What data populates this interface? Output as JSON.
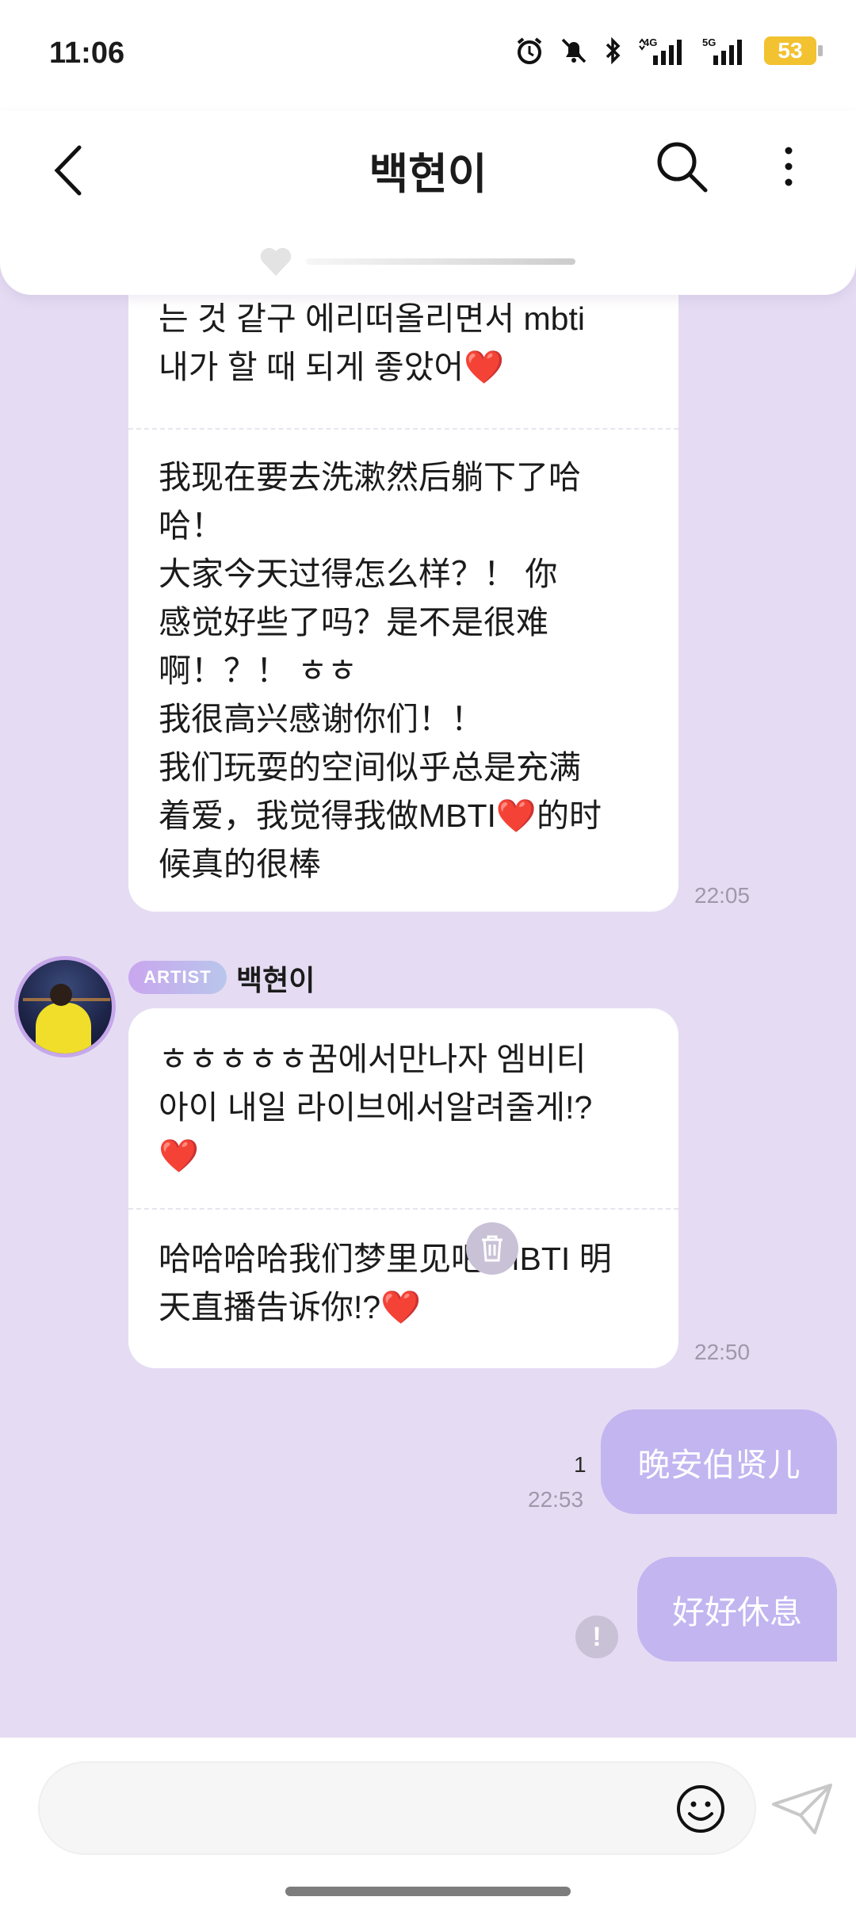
{
  "status_bar": {
    "time": "11:06",
    "net1": "4G",
    "net2": "5G",
    "battery": "53"
  },
  "header": {
    "title": "백현이"
  },
  "messages": {
    "first_bubble": {
      "korean": "는 것 같구 에리떠올리면서 mbti\n내가 할 때 되게 좋았어❤️",
      "chinese": "我现在要去洗漱然后躺下了哈\n哈！\n大家今天过得怎么样？！ 你\n感觉好些了吗？是不是很难\n啊！？！ ㅎㅎ\n我很高兴感谢你们！！\n我们玩耍的空间似乎总是充满\n着爱，我觉得我做MBTI❤️的时\n候真的很棒",
      "time": "22:05"
    },
    "sender": {
      "badge": "ARTIST",
      "name": "백현이"
    },
    "second_bubble": {
      "korean": "ㅎㅎㅎㅎㅎ꿈에서만나자 엠비티\n아이 내일 라이브에서알려줄게!?\n❤️",
      "chinese": "哈哈哈哈我们梦里见吧 MBTI 明\n天直播告诉你!?❤️",
      "time": "22:50"
    },
    "my_message_1": {
      "text": "晚安伯贤儿",
      "read_count": "1",
      "time": "22:53"
    },
    "my_message_2": {
      "text": "好好休息",
      "error_mark": "!"
    }
  },
  "colors": {
    "chat_background": "#e5dcf3",
    "my_bubble": "#c2b5f0",
    "badge": "#c9a6ee"
  }
}
